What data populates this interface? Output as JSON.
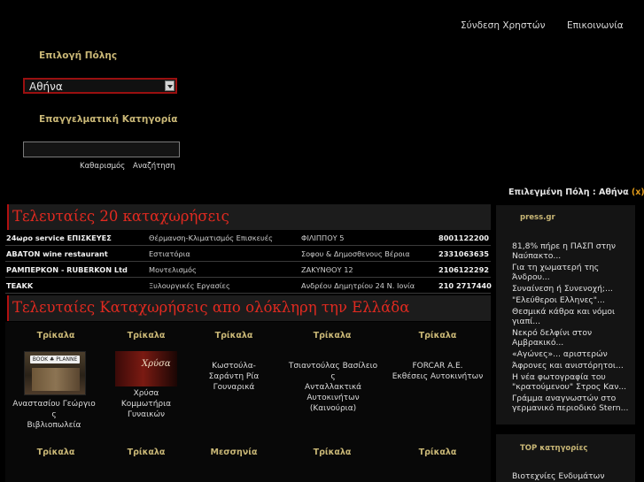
{
  "header": {
    "login_link": "Σύνδεση Χρηστών",
    "contact_link": "Επικοινωνία"
  },
  "search": {
    "city_label": "Επιλογή Πόλης",
    "city_value": "Αθήνα",
    "category_label": "Επαγγελματική Κατηγορία",
    "category_value": "",
    "clear_label": "Καθαρισμός",
    "search_label": "Αναζήτηση"
  },
  "selected_city": {
    "prefix": "Επιλεγμένη Πόλη : Αθήνα",
    "remove": "(x)"
  },
  "latest": {
    "title": "Τελευταίες 20 καταχωρήσεις",
    "rows": [
      {
        "name": "24ωρο service ΕΠΙΣΚΕΥΕΣ",
        "category": "Θέρμανση-Κλιματισμός Επισκευές",
        "address": "ΦΙΛΙΠΠΟΥ 5",
        "phone": "8001122200"
      },
      {
        "name": "ΑΒΑΤΟΝ wine restaurant",
        "category": "Εστιατόρια",
        "address": "Σοφου & Δημοσθενους Βέροια",
        "phone": "2331063635"
      },
      {
        "name": "ΡΑΜΠΕΡΚΟΝ - RUBERKON Ltd",
        "category": "Μοντελισμός",
        "address": "ΖΑΚΥΝΘΟΥ 12",
        "phone": "2106122292"
      },
      {
        "name": "ΤΕΑΚΚ",
        "category": "Ξυλουργικές Εργασίες",
        "address": "Ανδρέου Δημητρίου 24 Ν. Ιονία",
        "phone": "210 2717440"
      }
    ]
  },
  "greece": {
    "title": "Τελευταίες Καταχωρήσεις απο ολόκληρη την Ελλάδα",
    "cards": [
      {
        "city": "Τρίκαλα",
        "lines": [
          "Αναστασίου Γεώργιο",
          "ς",
          "Βιβλιοπωλεία"
        ],
        "thumb_text": "BOOK ♣ PLANNE"
      },
      {
        "city": "Τρίκαλα",
        "lines": [
          "Χρύσα",
          "Κομμωτήρια",
          "Γυναικών"
        ],
        "thumb_text": "Χρύσα"
      },
      {
        "city": "Τρίκαλα",
        "lines": [
          "Κωστούλα-",
          "Σαράντη Ρία",
          "Γουναρικά"
        ]
      },
      {
        "city": "Τρίκαλα",
        "lines": [
          "Τσιαντούλας Βασίλειο",
          "ς",
          "Ανταλλακτικά",
          "Αυτοκινήτων",
          "(Καινούρια)"
        ]
      },
      {
        "city": "Τρίκαλα",
        "lines": [
          "FORCAR A.E.",
          "Εκθέσεις Αυτοκινήτων"
        ]
      }
    ],
    "row2_cities": [
      "Τρίκαλα",
      "Τρίκαλα",
      "Μεσσηνία",
      "Τρίκαλα",
      "Τρίκαλα"
    ]
  },
  "sidebar": {
    "news_title": "press.gr",
    "news": [
      "81,8% πήρε η ΠΑΣΠ στην Ναύπακτο...",
      "Για τη χωματερή της Άνδρου...",
      "Συναίνεση ή Συνενοχή;...",
      "\"Ελεύθεροι Ελληνες\"...",
      "Θεσμικά κάθρα και νόμοι γιαπί...",
      "Νεκρό δελφίνι στον Αμβρακικό...",
      "«Αγώνες»... αριστερών",
      "Άφρονες και ανιστόρητοι...",
      "Η νέα φωτογραφία του \"κρατούμενου\" Στρος Καν...",
      "Γράμμα αναγνωστών στο γερμανικό περιοδικό Stern..."
    ],
    "top_title": "TOP κατηγορίες",
    "top_items": [
      "Βιοτεχνίες Ενδυμάτων"
    ]
  }
}
